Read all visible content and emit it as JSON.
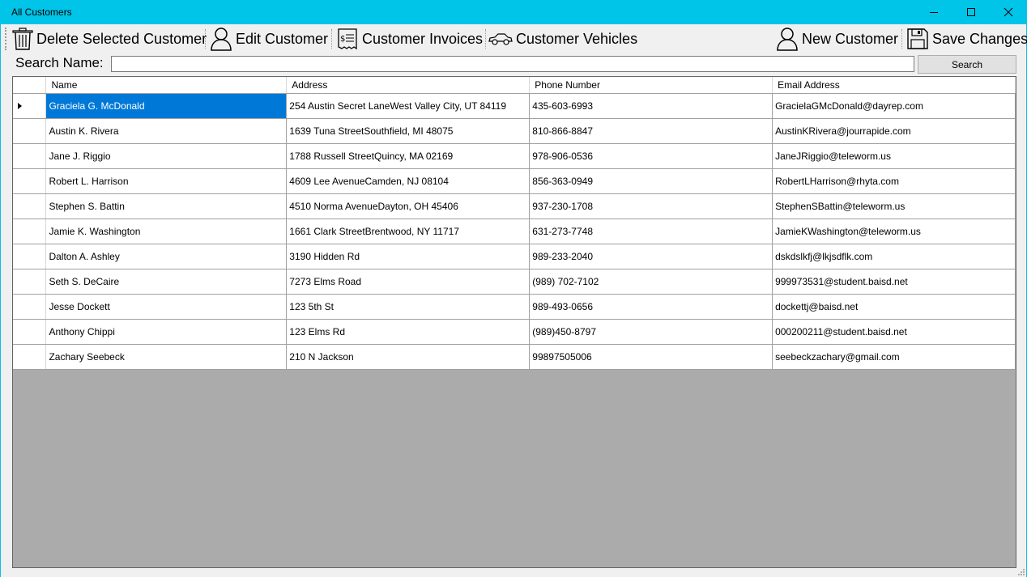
{
  "window": {
    "title": "All Customers"
  },
  "toolbar": {
    "delete_label": "Delete Selected Customer",
    "edit_label": "Edit Customer",
    "invoices_label": "Customer Invoices",
    "vehicles_label": "Customer Vehicles",
    "new_label": "New Customer",
    "save_label": "Save Changes"
  },
  "search": {
    "label": "Search Name:",
    "value": "",
    "button_label": "Search"
  },
  "grid": {
    "columns": [
      "Name",
      "Address",
      "Phone Number",
      "Email Address"
    ],
    "rows": [
      {
        "name": "Graciela G. McDonald",
        "address": "254 Austin Secret LaneWest Valley City, UT 84119",
        "phone": "435-603-6993",
        "email": "GracielaGMcDonald@dayrep.com"
      },
      {
        "name": "Austin K. Rivera",
        "address": "1639 Tuna StreetSouthfield, MI 48075",
        "phone": "810-866-8847",
        "email": "AustinKRivera@jourrapide.com"
      },
      {
        "name": "Jane J. Riggio",
        "address": "1788 Russell StreetQuincy, MA 02169",
        "phone": "978-906-0536",
        "email": "JaneJRiggio@teleworm.us"
      },
      {
        "name": "Robert L. Harrison",
        "address": "4609 Lee AvenueCamden, NJ 08104",
        "phone": "856-363-0949",
        "email": "RobertLHarrison@rhyta.com"
      },
      {
        "name": "Stephen S. Battin",
        "address": "4510 Norma AvenueDayton, OH 45406",
        "phone": "937-230-1708",
        "email": "StephenSBattin@teleworm.us"
      },
      {
        "name": "Jamie K. Washington",
        "address": "1661 Clark StreetBrentwood, NY 11717",
        "phone": "631-273-7748",
        "email": "JamieKWashington@teleworm.us"
      },
      {
        "name": "Dalton A. Ashley",
        "address": "3190  Hidden Rd",
        "phone": "989-233-2040",
        "email": "dskdslkfj@lkjsdflk.com"
      },
      {
        "name": "Seth S. DeCaire",
        "address": "7273  Elms Road",
        "phone": "(989) 702-7102",
        "email": "999973531@student.baisd.net"
      },
      {
        "name": "Jesse Dockett",
        "address": "123 5th St",
        "phone": "989-493-0656",
        "email": "dockettj@baisd.net"
      },
      {
        "name": "Anthony Chippi",
        "address": "123 Elms Rd",
        "phone": "(989)450-8797",
        "email": "000200211@student.baisd.net"
      },
      {
        "name": "Zachary Seebeck",
        "address": "210 N Jackson",
        "phone": "99897505006",
        "email": "seebeckzachary@gmail.com"
      }
    ]
  },
  "colors": {
    "titlebar": "#00c4e8",
    "selection": "#0078d7",
    "grid_background": "#ababab"
  }
}
